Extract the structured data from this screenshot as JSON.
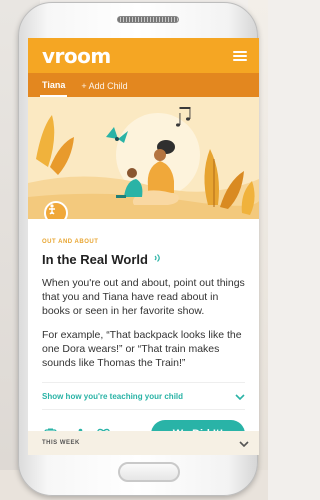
{
  "app": {
    "logo": "vroom"
  },
  "tabs": [
    {
      "label": "Tiana",
      "active": true
    },
    {
      "label": "+ Add Child",
      "active": false
    }
  ],
  "activity": {
    "eyebrow": "OUT AND ABOUT",
    "title": "In the Real World",
    "paragraphs": [
      "When you're out and about, point out things that you and Tiana have read about in books or seen in her favorite show.",
      "For example, “That backpack looks like the one Dora wears!” or “That train makes sounds like Thomas the Train!”"
    ],
    "teach_label": "Show how you're teaching your child"
  },
  "actions": {
    "did_it_label": "We Did It!",
    "icons": [
      "camera-icon",
      "share-icon",
      "heart-icon"
    ]
  },
  "footer": {
    "this_week_label": "THIS WEEK"
  },
  "colors": {
    "brand_orange": "#f5a623",
    "tab_orange": "#e3871f",
    "teal": "#29b3a7"
  }
}
